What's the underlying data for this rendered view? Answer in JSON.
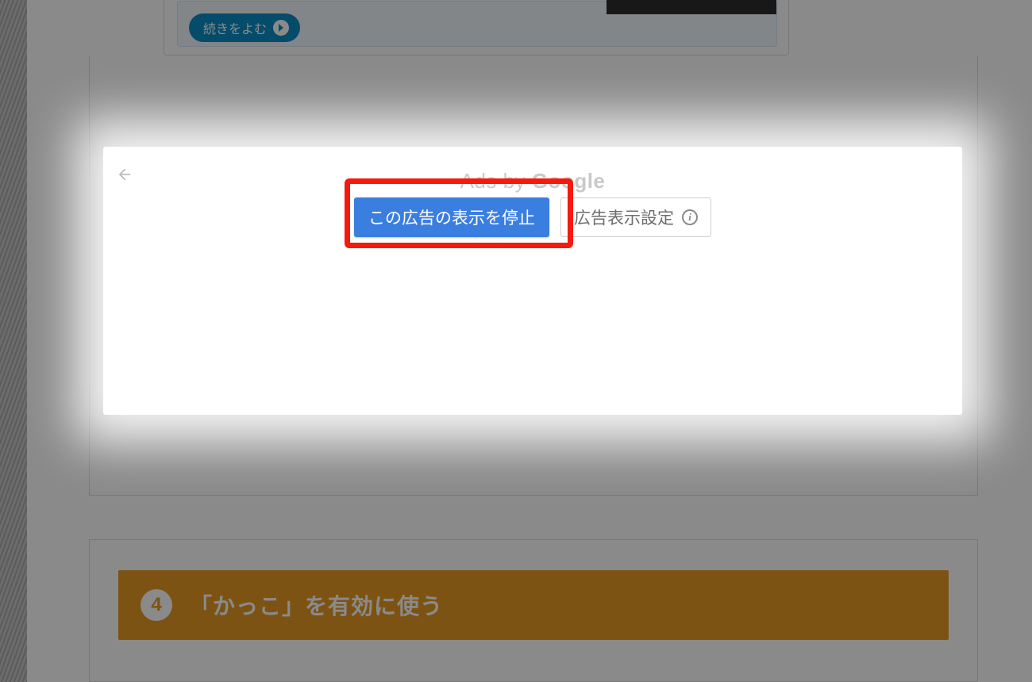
{
  "top_card": {
    "read_more_label": "続きをよむ"
  },
  "ad_panel": {
    "header_prefix": "Ads by ",
    "header_brand": "Google",
    "stop_button_label": "この広告の表示を停止",
    "settings_button_label": "広告表示設定",
    "info_glyph": "i"
  },
  "section": {
    "number": "4",
    "title": "「かっこ」を有効に使う"
  }
}
